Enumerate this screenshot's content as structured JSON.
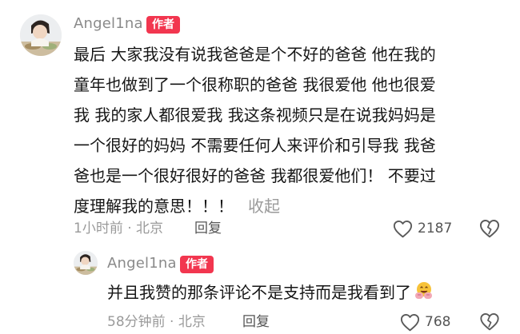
{
  "comment": {
    "username": "Angel1na",
    "badge": "作者",
    "text_lines": [
      "最后 大家我没有说我爸爸是个不好的爸爸 他在我的",
      "童年也做到了一个很称职的爸爸 我很爱他 他也很爱",
      "我 我的家人都很爱我 我这条视频只是在说我妈妈是",
      "一个很好的妈妈 不需要任何人来评价和引导我 我爸",
      "爸也是一个很好很好的爸爸 我都很爱他们！ 不要过",
      "度理解我的意思！！！"
    ],
    "collapse_label": "收起",
    "time_location": "1小时前 · 北京",
    "reply_label": "回复",
    "like_count": "2187"
  },
  "reply": {
    "username": "Angel1na",
    "badge": "作者",
    "text": "并且我赞的那条评论不是支持而是我看到了",
    "emoji": "hugging-face",
    "time_location": "58分钟前 · 北京",
    "reply_label": "回复",
    "like_count": "768"
  },
  "colors": {
    "badge": "#f2364f",
    "meta": "#9a9a9a",
    "text": "#161616"
  }
}
